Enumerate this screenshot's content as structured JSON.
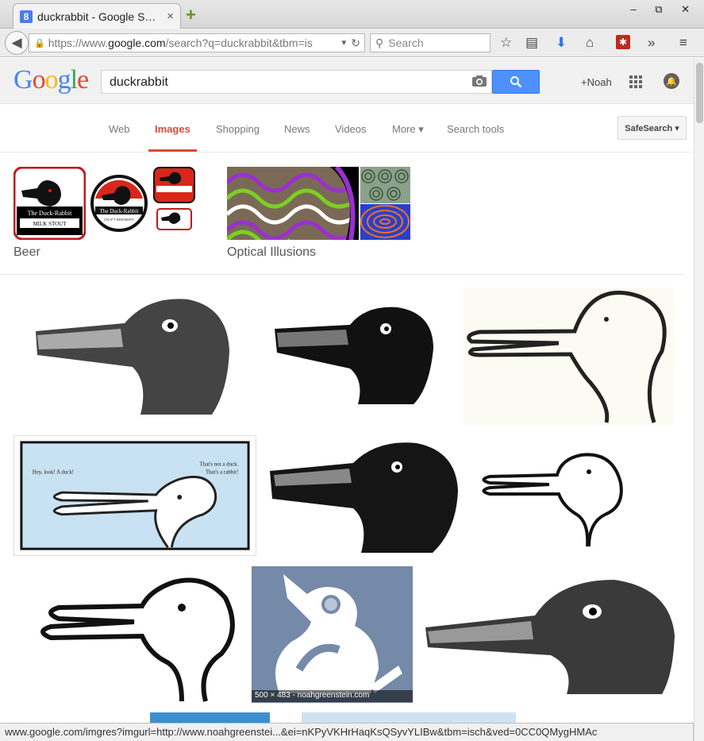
{
  "browser": {
    "tab_title": "duckrabbit - Google S…",
    "tab_favicon": "8",
    "tab_close": "×",
    "new_tab": "+",
    "url_prefix": "https://www.",
    "url_domain": "google.com",
    "url_rest": "/search?q=duckrabbit&tbm=is",
    "search_placeholder": "Search",
    "window_controls": "‒ ⧉ ✕",
    "status_url": "www.google.com/imgres?imgurl=http://www.noahgreenstei...&ei=nKPyVKHrHaqKsQSyvYLIBw&tbm=isch&ved=0CC0QMygHMAc"
  },
  "google": {
    "logo": [
      "G",
      "o",
      "o",
      "g",
      "l",
      "e"
    ],
    "logo_colors": [
      "#4285f4",
      "#ea4335",
      "#fbbc05",
      "#4285f4",
      "#34a853",
      "#ea4335"
    ],
    "query": "duckrabbit",
    "user": "+Noah",
    "accent": "#dd4b39",
    "button_blue": "#4d90fe"
  },
  "tabs": [
    {
      "label": "Web"
    },
    {
      "label": "Images",
      "active": true
    },
    {
      "label": "Shopping"
    },
    {
      "label": "News"
    },
    {
      "label": "Videos"
    },
    {
      "label": "More ▾"
    },
    {
      "label": "Search tools"
    }
  ],
  "safesearch": "SafeSearch ▾",
  "collections": [
    {
      "label": "Beer"
    },
    {
      "label": "Optical Illusions"
    }
  ],
  "beer_labels": {
    "brand": "The Duck-Rabbit",
    "style": "MILK STOUT",
    "craft": "CRAFT BREWERY"
  },
  "results": {
    "speech_left": "Hey, look! A duck!",
    "speech_right_1": "That's not a duck.",
    "speech_right_2": "That's a rabbit!",
    "hover_info": "500 × 483 - noahgreenstein.com"
  }
}
